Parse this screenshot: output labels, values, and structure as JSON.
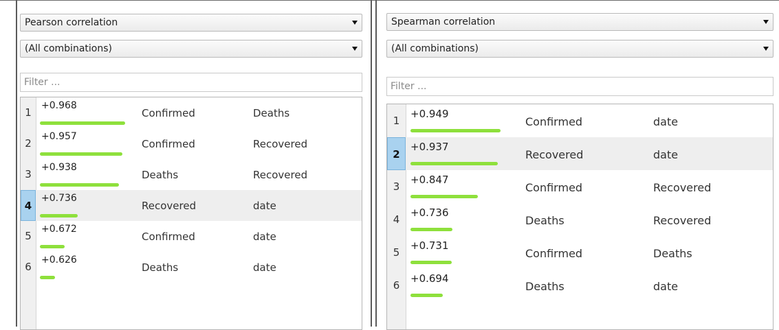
{
  "left": {
    "method": "Pearson correlation",
    "combination": "(All combinations)",
    "filter_placeholder": "Filter ...",
    "selected_index": 3,
    "rows": [
      {
        "rank": "1",
        "value": "+0.968",
        "attr1": "Confirmed",
        "attr2": "Deaths",
        "strength": 0.968
      },
      {
        "rank": "2",
        "value": "+0.957",
        "attr1": "Confirmed",
        "attr2": "Recovered",
        "strength": 0.957
      },
      {
        "rank": "3",
        "value": "+0.938",
        "attr1": "Deaths",
        "attr2": "Recovered",
        "strength": 0.938
      },
      {
        "rank": "4",
        "value": "+0.736",
        "attr1": "Recovered",
        "attr2": "date",
        "strength": 0.736
      },
      {
        "rank": "5",
        "value": "+0.672",
        "attr1": "Confirmed",
        "attr2": "date",
        "strength": 0.672
      },
      {
        "rank": "6",
        "value": "+0.626",
        "attr1": "Deaths",
        "attr2": "date",
        "strength": 0.626
      }
    ]
  },
  "right": {
    "method": "Spearman correlation",
    "combination": "(All combinations)",
    "filter_placeholder": "Filter ...",
    "selected_index": 1,
    "rows": [
      {
        "rank": "1",
        "value": "+0.949",
        "attr1": "Confirmed",
        "attr2": "date",
        "strength": 0.949
      },
      {
        "rank": "2",
        "value": "+0.937",
        "attr1": "Recovered",
        "attr2": "date",
        "strength": 0.937
      },
      {
        "rank": "3",
        "value": "+0.847",
        "attr1": "Confirmed",
        "attr2": "Recovered",
        "strength": 0.847
      },
      {
        "rank": "4",
        "value": "+0.736",
        "attr1": "Deaths",
        "attr2": "Recovered",
        "strength": 0.736
      },
      {
        "rank": "5",
        "value": "+0.731",
        "attr1": "Confirmed",
        "attr2": "Deaths",
        "strength": 0.731
      },
      {
        "rank": "6",
        "value": "+0.694",
        "attr1": "Deaths",
        "attr2": "date",
        "strength": 0.694
      }
    ]
  },
  "colors": {
    "bar": "#8ee03c",
    "selection": "#a9d2ef"
  }
}
